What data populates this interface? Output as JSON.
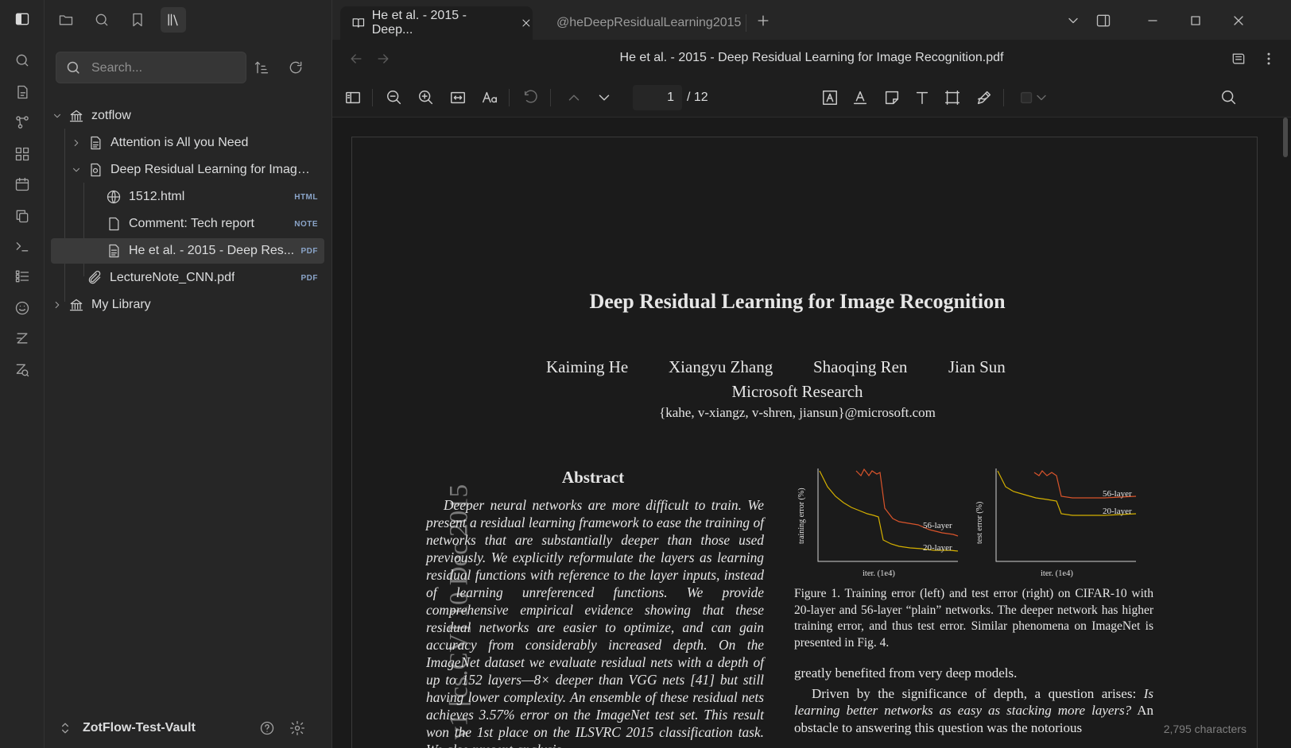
{
  "sidebar": {
    "search_placeholder": "Search...",
    "vault_name": "ZotFlow-Test-Vault",
    "tree": [
      {
        "label": "zotflow",
        "icon": "library-icon",
        "expanded": true
      },
      {
        "label": "Attention is All you Need",
        "icon": "document-icon",
        "expanded": false
      },
      {
        "label": "Deep Residual Learning for Image ...",
        "icon": "item-icon",
        "expanded": true
      },
      {
        "label": "1512.html",
        "icon": "globe-icon",
        "badge": "HTML"
      },
      {
        "label": "Comment: Tech report",
        "icon": "note-icon",
        "badge": "NOTE"
      },
      {
        "label": "He et al. - 2015 - Deep Res...",
        "icon": "pdf-icon",
        "badge": "PDF"
      },
      {
        "label": "LectureNote_CNN.pdf",
        "icon": "paperclip-icon",
        "badge": "PDF"
      },
      {
        "label": "My Library",
        "icon": "library-icon",
        "expanded": false
      }
    ]
  },
  "tabs": [
    {
      "label": "He et al. - 2015 - Deep...",
      "active": true
    },
    {
      "label": "@heDeepResidualLearning2015",
      "active": false
    }
  ],
  "file_title": "He et al. - 2015 - Deep Residual Learning for Image Recognition.pdf",
  "pdf_toolbar": {
    "page_current": "1",
    "page_total": "/ 12"
  },
  "paper": {
    "title": "Deep Residual Learning for Image Recognition",
    "authors": [
      "Kaiming He",
      "Xiangyu Zhang",
      "Shaoqing Ren",
      "Jian Sun"
    ],
    "affiliation": "Microsoft Research",
    "email": "{kahe, v-xiangz, v-shren, jiansun}@microsoft.com",
    "arxiv_stamp": "v1  [cs.CV]  10 Dec 2015",
    "abstract_heading": "Abstract",
    "abstract": "Deeper neural networks are more difficult to train. We present a residual learning framework to ease the training of networks that are substantially deeper than those used previously. We explicitly reformulate the layers as learning residual functions with reference to the layer inputs, instead of learning unreferenced functions. We provide comprehensive empirical evidence showing that these residual networks are easier to optimize, and can gain accuracy from considerably increased depth. On the ImageNet dataset we evaluate residual nets with a depth of up to 152 layers—8× deeper than VGG nets [41] but still having lower complexity. An ensemble of these residual nets achieves 3.57% error on the ImageNet test set. This result won the 1st place on the ILSVRC 2015 classification task. We also present analysis",
    "figure_caption": "Figure 1. Training error (left) and test error (right) on CIFAR-10 with 20-layer and 56-layer “plain” networks. The deeper network has higher training error, and thus test error. Similar phenomena on ImageNet is presented in Fig. 4.",
    "body_p1": "greatly benefited from very deep models.",
    "body_p2_start": "Driven by the significance of depth, a question arises: ",
    "body_p2_italic": "Is learning better networks as easy as stacking more layers?",
    "body_p2_end": " An obstacle to answering this question was the notorious",
    "fig_left_ylabel": "training error (%)",
    "fig_right_ylabel": "test error (%)",
    "fig_xlabel": "iter. (1e4)",
    "series_56": "56-layer",
    "series_20": "20-layer"
  },
  "status": {
    "characters": "2,795 characters"
  }
}
